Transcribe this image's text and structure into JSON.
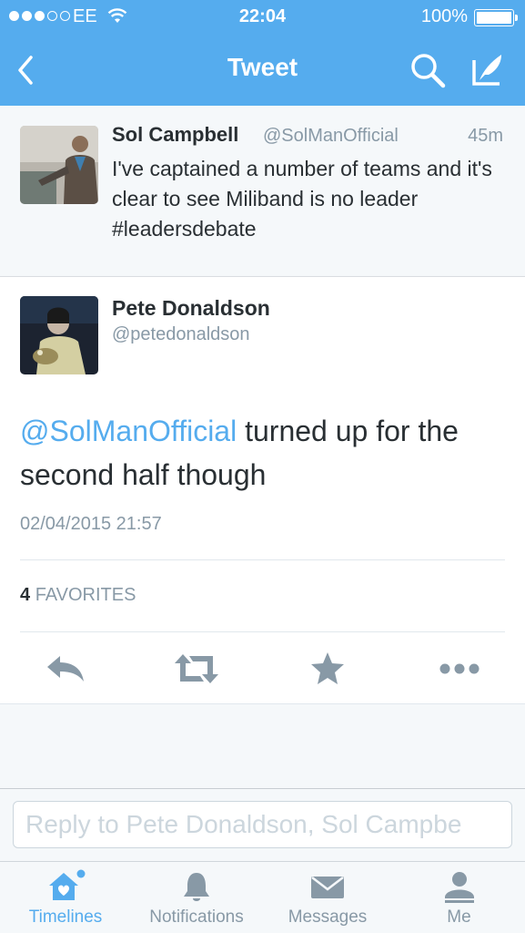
{
  "status_bar": {
    "carrier": "EE",
    "time": "22:04",
    "battery": "100%"
  },
  "nav": {
    "title": "Tweet"
  },
  "parent_tweet": {
    "name": "Sol Campbell",
    "handle": "@SolManOfficial",
    "time": "45m",
    "text": "I've captained a number of teams and it's clear to see Miliband is no leader #leadersdebate"
  },
  "main_tweet": {
    "name": "Pete Donaldson",
    "handle": "@petedonaldson",
    "mention": "@SolManOfficial",
    "text": " turned up for the second half though",
    "date": "02/04/2015 21:57",
    "favorites_count": "4",
    "favorites_label": "FAVORITES"
  },
  "actions": {
    "icons": [
      "reply-icon",
      "retweet-icon",
      "favorite-star-icon",
      "more-dots-icon"
    ]
  },
  "reply": {
    "placeholder": "Reply to Pete Donaldson, Sol Campbe"
  },
  "tabs": [
    {
      "label": "Timelines",
      "icon": "home-icon",
      "active": true
    },
    {
      "label": "Notifications",
      "icon": "bell-icon",
      "active": false
    },
    {
      "label": "Messages",
      "icon": "envelope-icon",
      "active": false
    },
    {
      "label": "Me",
      "icon": "person-icon",
      "active": false
    }
  ],
  "colors": {
    "accent": "#55acee",
    "text": "#292f33",
    "muted": "#8899a6",
    "background_gray": "#f5f8fa"
  }
}
